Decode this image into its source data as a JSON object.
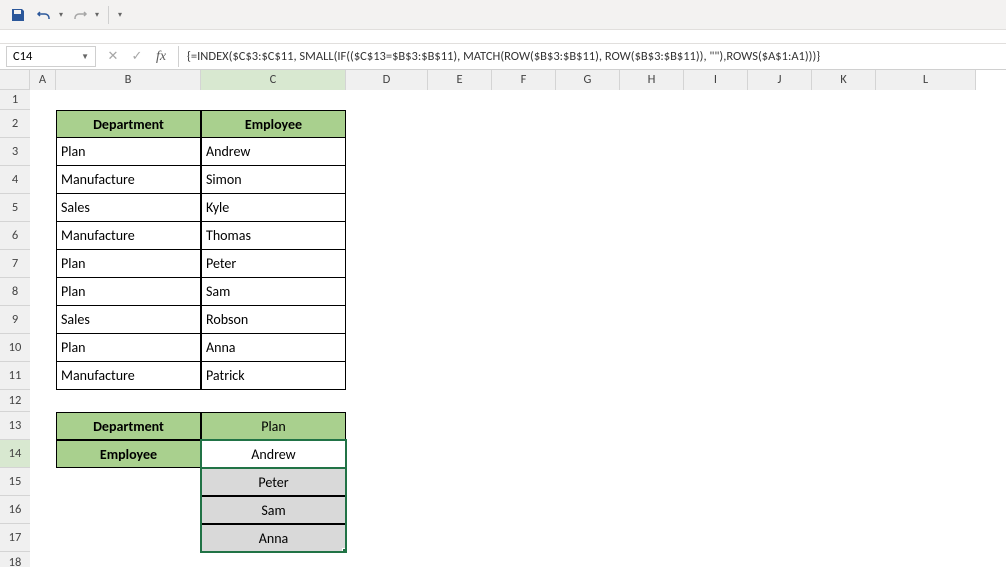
{
  "namebox": "C14",
  "formula": "{=INDEX($C$3:$C$11, SMALL(IF(($C$13=$B$3:$B$11), MATCH(ROW($B$3:$B$11), ROW($B$3:$B$11)), \"\"),ROWS($A$1:A1)))}",
  "columns": [
    "A",
    "B",
    "C",
    "D",
    "E",
    "F",
    "G",
    "H",
    "I",
    "J",
    "K",
    "L"
  ],
  "colWidths": {
    "A": 26,
    "B": 145,
    "C": 145,
    "D": 82,
    "E": 64,
    "F": 64,
    "G": 64,
    "H": 64,
    "I": 64,
    "J": 64,
    "K": 64,
    "L": 100
  },
  "rowCount": 18,
  "rowHeights": {
    "1": 20,
    "2": 28,
    "3": 28,
    "4": 28,
    "5": 28,
    "6": 28,
    "7": 28,
    "8": 28,
    "9": 28,
    "10": 28,
    "11": 28,
    "12": 22,
    "13": 28,
    "14": 28,
    "15": 28,
    "16": 28,
    "17": 28,
    "18": 22
  },
  "selectedCol": "C",
  "selectedRow": 14,
  "table1": {
    "headers": {
      "dept": "Department",
      "emp": "Employee"
    },
    "rows": [
      {
        "dept": "Plan",
        "emp": "Andrew"
      },
      {
        "dept": "Manufacture",
        "emp": "Simon"
      },
      {
        "dept": "Sales",
        "emp": "Kyle"
      },
      {
        "dept": "Manufacture",
        "emp": "Thomas"
      },
      {
        "dept": "Plan",
        "emp": "Peter"
      },
      {
        "dept": "Plan",
        "emp": "Sam"
      },
      {
        "dept": "Sales",
        "emp": "Robson"
      },
      {
        "dept": "Plan",
        "emp": "Anna"
      },
      {
        "dept": "Manufacture",
        "emp": "Patrick"
      }
    ]
  },
  "table2": {
    "deptLabel": "Department",
    "deptValue": "Plan",
    "empLabel": "Employee",
    "results": [
      "Andrew",
      "Peter",
      "Sam",
      "Anna"
    ]
  },
  "icons": {
    "save": "save-icon",
    "undo": "undo-icon",
    "redo": "redo-icon"
  }
}
